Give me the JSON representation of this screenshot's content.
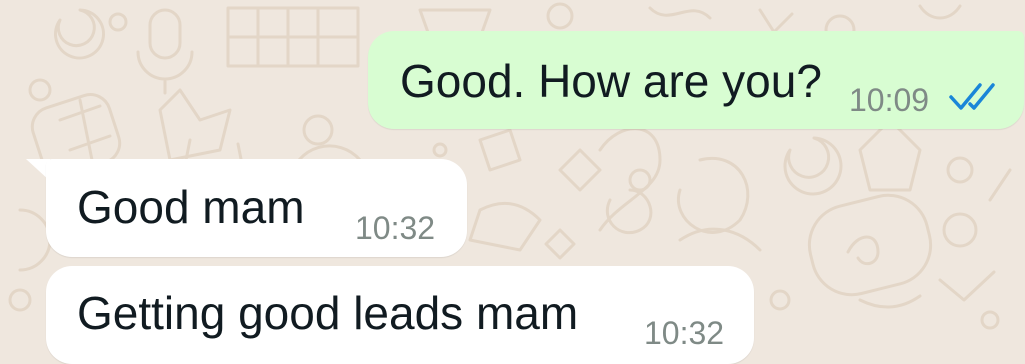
{
  "colors": {
    "background": "#efe7de",
    "outgoing_bubble": "#d8fdd2",
    "incoming_bubble": "#ffffff",
    "text": "#111b21",
    "timestamp": "#7f8a86",
    "read_ticks": "#1a86d8"
  },
  "messages": [
    {
      "direction": "outgoing",
      "text": "Good. How are you?",
      "time": "10:09",
      "status_icon": "double-check-read-icon"
    },
    {
      "direction": "incoming",
      "text": "Good mam",
      "time": "10:32"
    },
    {
      "direction": "incoming",
      "text": "Getting good leads mam",
      "time": "10:32"
    }
  ]
}
